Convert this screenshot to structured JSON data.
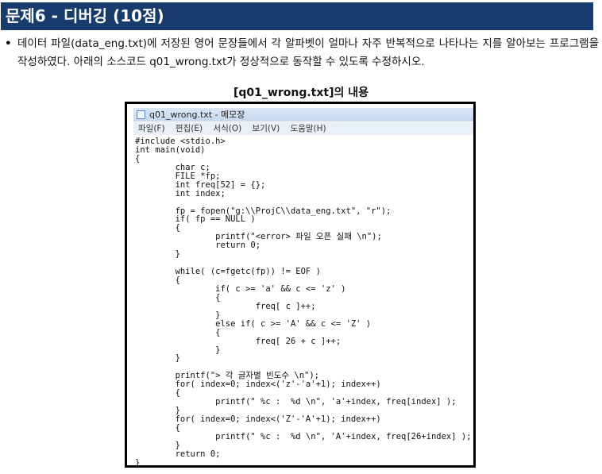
{
  "header": {
    "title": "문제6 - 디버깅 (10점)"
  },
  "question": {
    "bullet": "•",
    "text": "데이터 파일(data_eng.txt)에 저장된 영어 문장들에서 각 알파벳이 얼마나 자주 반복적으로 나타나는 지를 알아보는 프로그램을 작성하였다. 아래의 소스코드 q01_wrong.txt가 정상적으로 동작할 수 있도록 수정하시오."
  },
  "caption": "[q01_wrong.txt]의 내용",
  "notepad": {
    "title": "q01_wrong.txt - 메모장",
    "menu": [
      "파일(F)",
      "편집(E)",
      "서식(O)",
      "보기(V)",
      "도움말(H)"
    ],
    "code_lines": [
      "#include <stdio.h>",
      "int main(void)",
      "{",
      "        char c;",
      "        FILE *fp;",
      "        int freq[52] = {};",
      "        int index;",
      "",
      "        fp = fopen(\"g:\\\\ProjC\\\\data_eng.txt\", \"r\");",
      "        if( fp == NULL )",
      "        {",
      "                printf(\"<error> 파일 오픈 실패 \\n\");",
      "                return 0;",
      "        }",
      "",
      "        while( (c=fgetc(fp)) != EOF )",
      "        {",
      "                if( c >= 'a' && c <= 'z' )",
      "                {",
      "                        freq[ c ]++;",
      "                }",
      "                else if( c >= 'A' && c <= 'Z' )",
      "                {",
      "                        freq[ 26 + c ]++;",
      "                }",
      "        }",
      "",
      "        printf(\"> 각 글자별 빈도수 \\n\");",
      "        for( index=0; index<('z'-'a'+1); index++)",
      "        {",
      "                printf(\" %c :  %d \\n\", 'a'+index, freq[index] );",
      "        }",
      "        for( index=0; index<('Z'-'A'+1); index++)",
      "        {",
      "                printf(\" %c :  %d \\n\", 'A'+index, freq[26+index] );",
      "        }",
      "        return 0;",
      "}"
    ]
  }
}
